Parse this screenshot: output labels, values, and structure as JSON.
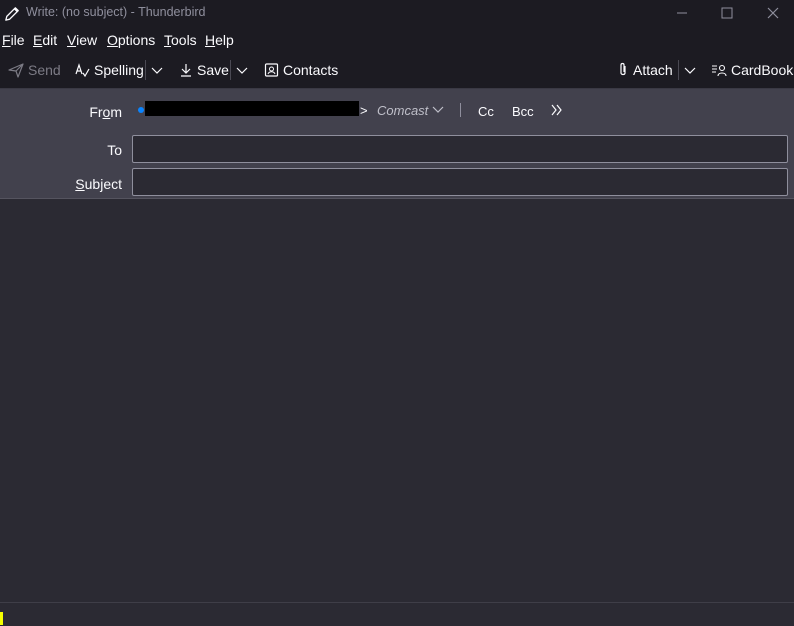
{
  "window": {
    "title": "Write: (no subject) - Thunderbird",
    "controls": [
      "minimize-icon",
      "maximize-icon",
      "close-icon"
    ]
  },
  "menu": {
    "file": {
      "mnemonic": "F",
      "rest": "ile"
    },
    "edit": {
      "mnemonic": "E",
      "rest": "dit"
    },
    "view": {
      "mnemonic": "V",
      "rest": "iew"
    },
    "options": {
      "mnemonic": "O",
      "rest": "ptions"
    },
    "tools": {
      "mnemonic": "T",
      "rest": "ools"
    },
    "help": {
      "mnemonic": "H",
      "rest": "elp"
    }
  },
  "toolbar": {
    "send": "Send",
    "spelling": "Spelling",
    "save": "Save",
    "contacts": "Contacts",
    "attach": "Attach",
    "cardbook": "CardBook"
  },
  "compose": {
    "from_label": {
      "pre": "Fr",
      "mnemonic": "o",
      "post": "m"
    },
    "from_suffix": ">",
    "from_account": "Comcast",
    "cc": "Cc",
    "bcc": "Bcc",
    "to_label": "To",
    "subject_label": {
      "mnemonic": "S",
      "rest": "ubject"
    },
    "to_value": "",
    "subject_value": ""
  },
  "colors": {
    "accent": "#0a84ff",
    "status_marker": "#f5ff00"
  }
}
